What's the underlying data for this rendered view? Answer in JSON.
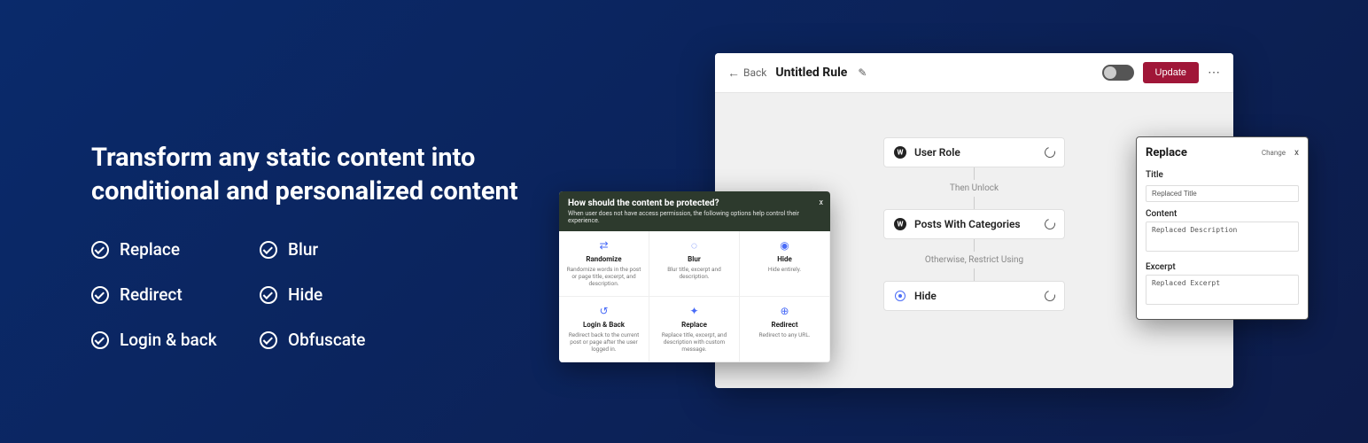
{
  "hero": {
    "title": "Transform any static content into conditional and personalized content",
    "features": [
      "Replace",
      "Blur",
      "Redirect",
      "Hide",
      "Login & back",
      "Obfuscate"
    ]
  },
  "editor": {
    "back": "Back",
    "title": "Untitled Rule",
    "update": "Update",
    "flow": {
      "cards": [
        {
          "label": "User Role",
          "icon": "wordpress"
        },
        {
          "label": "Posts With Categories",
          "icon": "wordpress"
        },
        {
          "label": "Hide",
          "icon": "hide"
        }
      ],
      "labels": [
        "Then Unlock",
        "Otherwise, Restrict Using"
      ]
    }
  },
  "modal": {
    "title": "How should the content be protected?",
    "subtitle": "When user does not have access permission, the following options help control their experience.",
    "options": [
      {
        "title": "Randomize",
        "desc": "Randomize words in the post or page title, excerpt, and description."
      },
      {
        "title": "Blur",
        "desc": "Blur title, excerpt and description."
      },
      {
        "title": "Hide",
        "desc": "Hide entirely."
      },
      {
        "title": "Login & Back",
        "desc": "Redirect back to the current post or page after the user logged in."
      },
      {
        "title": "Replace",
        "desc": "Replace title, excerpt, and description with custom message."
      },
      {
        "title": "Redirect",
        "desc": "Redirect to any URL."
      }
    ]
  },
  "sidePanel": {
    "title": "Replace",
    "change": "Change",
    "fields": {
      "titleLabel": "Title",
      "titleValue": "Replaced Title",
      "contentLabel": "Content",
      "contentValue": "Replaced Description",
      "excerptLabel": "Excerpt",
      "excerptValue": "Replaced Excerpt"
    }
  }
}
